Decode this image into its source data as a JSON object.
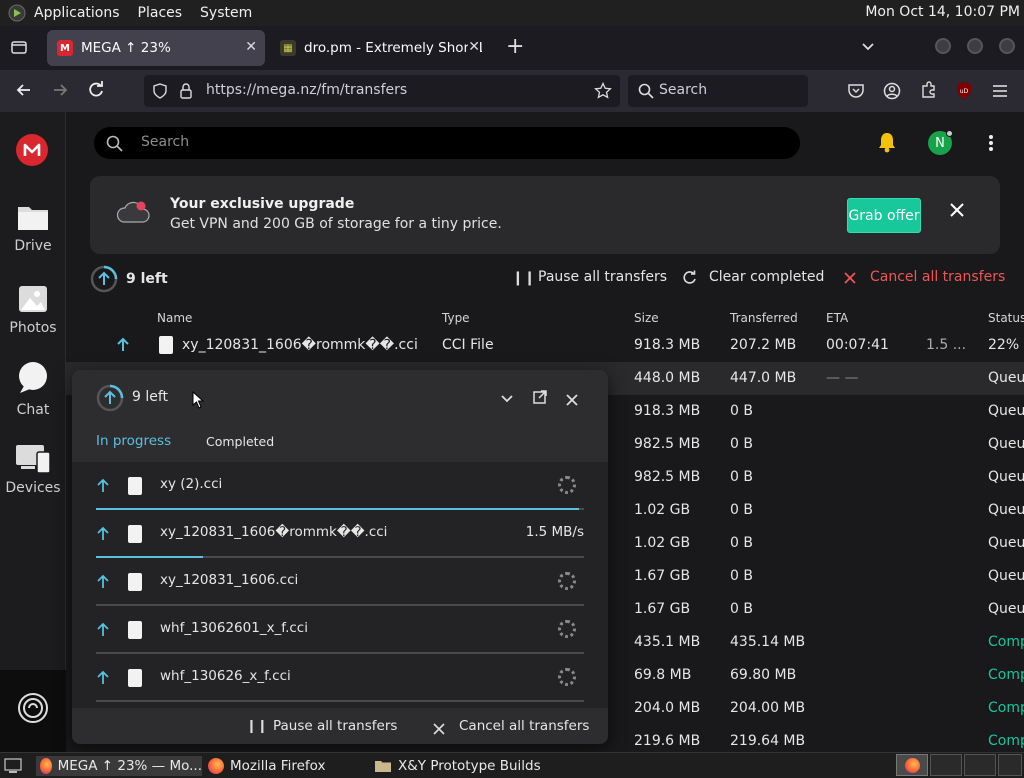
{
  "panel": {
    "menu": [
      "Applications",
      "Places",
      "System"
    ],
    "clock": "Mon Oct 14, 10:07 PM"
  },
  "tabs": [
    {
      "label": "MEGA ↑ 23%"
    },
    {
      "label": "dro.pm - Extremely Short Li"
    }
  ],
  "navbar": {
    "url": "https://mega.nz/fm/transfers",
    "search_placeholder": "Search"
  },
  "sidebar": {
    "items": [
      {
        "label": "Drive"
      },
      {
        "label": "Photos"
      },
      {
        "label": "Chat"
      },
      {
        "label": "Devices"
      }
    ]
  },
  "topbar": {
    "search_placeholder": "Search",
    "avatar_letter": "N"
  },
  "banner": {
    "title": "Your exclusive upgrade",
    "subtitle": "Get VPN and 200 GB of storage for a tiny price.",
    "button": "Grab offer"
  },
  "transfers_header": {
    "left": "9 left",
    "pause": "Pause all transfers",
    "clear": "Clear completed",
    "cancel": "Cancel all transfers"
  },
  "columns": [
    "Name",
    "Type",
    "Size",
    "Transferred",
    "ETA",
    "Status"
  ],
  "rows": [
    {
      "name": "xy_120831_1606�rommk��.cci",
      "type": "CCI File",
      "size": "918.3 MB",
      "transferred": "207.2 MB",
      "eta": "00:07:41",
      "speed": "1.5 ...",
      "status": "22%"
    },
    {
      "size": "448.0 MB",
      "transferred": "447.0 MB",
      "eta": "— —",
      "status": "Queu"
    },
    {
      "size": "918.3 MB",
      "transferred": "0 B",
      "status": "Queu"
    },
    {
      "size": "982.5 MB",
      "transferred": "0 B",
      "status": "Queu"
    },
    {
      "size": "982.5 MB",
      "transferred": "0 B",
      "status": "Queu"
    },
    {
      "size": "1.02 GB",
      "transferred": "0 B",
      "status": "Queu"
    },
    {
      "size": "1.02 GB",
      "transferred": "0 B",
      "status": "Queu"
    },
    {
      "size": "1.67 GB",
      "transferred": "0 B",
      "status": "Queu"
    },
    {
      "size": "1.67 GB",
      "transferred": "0 B",
      "status": "Queu"
    },
    {
      "size": "435.1 MB",
      "transferred": "435.14 MB",
      "status": "Comp"
    },
    {
      "size": "69.8 MB",
      "transferred": "69.80 MB",
      "status": "Comp"
    },
    {
      "size": "204.0 MB",
      "transferred": "204.00 MB",
      "status": "Comp"
    },
    {
      "size": "219.6 MB",
      "transferred": "219.64 MB",
      "status": "Comp"
    }
  ],
  "popup": {
    "left": "9 left",
    "tab_in_progress": "In progress",
    "tab_completed": "Completed",
    "items": [
      {
        "name": "xy (2).cci",
        "progress": 0.99
      },
      {
        "name": "xy_120831_1606�rommk��.cci",
        "speed": "1.5 MB/s",
        "progress": 0.22
      },
      {
        "name": "xy_120831_1606.cci",
        "progress": 0
      },
      {
        "name": "whf_13062601_x_f.cci",
        "progress": 0
      },
      {
        "name": "whf_130626_x_f.cci",
        "progress": 0
      }
    ],
    "pause": "Pause all transfers",
    "cancel": "Cancel all transfers"
  },
  "taskbar": {
    "items": [
      "MEGA ↑ 23% — Mo...",
      "Mozilla Firefox",
      "X&Y Prototype Builds"
    ]
  },
  "colors": {
    "mega_red": "#d9272e",
    "accent_green": "#18c79a",
    "cancel_red": "#f05555",
    "progress_blue": "#5bc0de"
  }
}
